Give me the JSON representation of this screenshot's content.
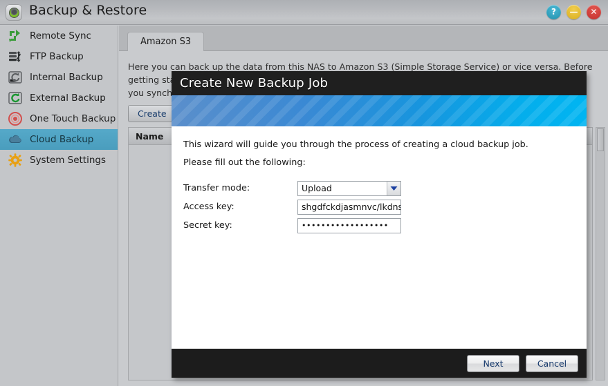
{
  "window": {
    "title": "Backup & Restore",
    "app_icon": "backup-restore-icon",
    "buttons": [
      {
        "name": "help-button",
        "glyph": "?",
        "color": "#2392ae"
      },
      {
        "name": "minimize-button",
        "glyph": "—",
        "color": "#d9ae1e"
      },
      {
        "name": "close-button",
        "glyph": "✕",
        "color": "#c32f2c"
      }
    ]
  },
  "sidebar": {
    "items": [
      {
        "label": "Remote Sync",
        "icon": "remote-sync-icon",
        "active": false
      },
      {
        "label": "FTP Backup",
        "icon": "ftp-backup-icon",
        "active": false
      },
      {
        "label": "Internal Backup",
        "icon": "internal-backup-icon",
        "active": false
      },
      {
        "label": "External Backup",
        "icon": "external-backup-icon",
        "active": false
      },
      {
        "label": "One Touch Backup",
        "icon": "one-touch-backup-icon",
        "active": false
      },
      {
        "label": "Cloud Backup",
        "icon": "cloud-backup-icon",
        "active": true
      },
      {
        "label": "System Settings",
        "icon": "system-settings-icon",
        "active": false
      }
    ],
    "active_color": "#4fa3c3"
  },
  "main": {
    "tab": {
      "label": "Amazon S3"
    },
    "description": "Here you can back up the data from this NAS to Amazon S3 (Simple Storage Service) or vice versa. Before getting started, please make sure your system time and timezone are set correctly. It is suggested that you synchronize the time on your NAS with a NTP server.",
    "create_button": "Create",
    "table": {
      "columns": [
        "Name"
      ],
      "rows": []
    }
  },
  "dialog": {
    "title": "Create New Backup Job",
    "intro": "This wizard will guide you through the process of creating a cloud backup job.",
    "instruction": "Please fill out the following:",
    "fields": [
      {
        "label": "Transfer mode:",
        "type": "select",
        "value": "Upload",
        "icon": "chevron-down-icon"
      },
      {
        "label": "Access key:",
        "type": "text",
        "value": "shgdfckdjasmnvc/lkdns."
      },
      {
        "label": "Secret key:",
        "type": "password",
        "value": "••••••••••••••••••"
      }
    ],
    "buttons": [
      {
        "label": "Next",
        "name": "next-button"
      },
      {
        "label": "Cancel",
        "name": "cancel-button"
      }
    ]
  }
}
